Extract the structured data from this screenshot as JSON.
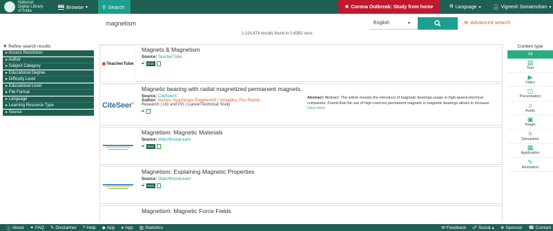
{
  "brand": {
    "logo_line1": "National",
    "logo_line2": "Digital Library",
    "logo_line3": "of India"
  },
  "nav": {
    "browse": "Browse",
    "search_tab": "Search",
    "corona": "Corona Outbreak: Study from home",
    "language": "Language",
    "user": "Vignesh Somamohan"
  },
  "search": {
    "query": "magnetism",
    "language": "English",
    "advanced": "Advanced search",
    "results_info": "1,116,674 results found in 0.6392 secs"
  },
  "sidebar": {
    "title": "Refine search results",
    "filters": [
      "Access Restriction",
      "Author",
      "Subject Category",
      "Educational Degree",
      "Difficulty Level",
      "Educational Level",
      "File Format",
      "Language",
      "Learning Resource Type",
      "Source"
    ]
  },
  "results": [
    {
      "title": "Magnets & Magnetism",
      "source_label": "Source:",
      "source": "TeacherTube",
      "thumb": "TeacherTube"
    },
    {
      "title": "Magnetic bearing with radial magnetized permanent magnets.",
      "source_label": "Source:",
      "source": "CiteSeerX",
      "author_label": "Author:",
      "authors": "Vavilov, Vyacheslav Evgenevich | Ismagilov, Flur Rashit...",
      "meta": "Research  |  UG and PG  |  Career/Technical Study",
      "abstract_label": "Abstract:",
      "abstract": "Abstract: The article reveals the relevance of magnetic bearings usage in high-speed electrical complexes. Found that the use of high-coercive permanent magnets in magnetic bearings allows to increase",
      "view_more": "View more",
      "thumb": "CiteSeer"
    },
    {
      "title": "Magnetism: Magnetic Materials",
      "source_label": "Source:",
      "source": "WatchKnowLearn"
    },
    {
      "title": "Magnetism: Explaining Magnetic Properties",
      "source_label": "Source:",
      "source": "WatchKnowLearn"
    },
    {
      "title": "Magnetism: Magnetic Force Fields"
    }
  ],
  "badge_eng": "ENG",
  "content_type": {
    "title": "Content type",
    "all": "All",
    "items": [
      "Text",
      "Video",
      "Presentation",
      "Audio",
      "Image",
      "Simulation",
      "Application",
      "Animation"
    ]
  },
  "footer": {
    "left": [
      "About",
      "FAQ",
      "Disclaimer",
      "Help",
      "App",
      "App",
      "Statistics"
    ],
    "right": [
      "Feedback",
      "Social",
      "Sponsor",
      "Contact"
    ]
  },
  "colors": {
    "primary": "#1f5f52",
    "accent": "#1c9f8c",
    "alert": "#c0192e",
    "advanced": "#e2572c"
  }
}
